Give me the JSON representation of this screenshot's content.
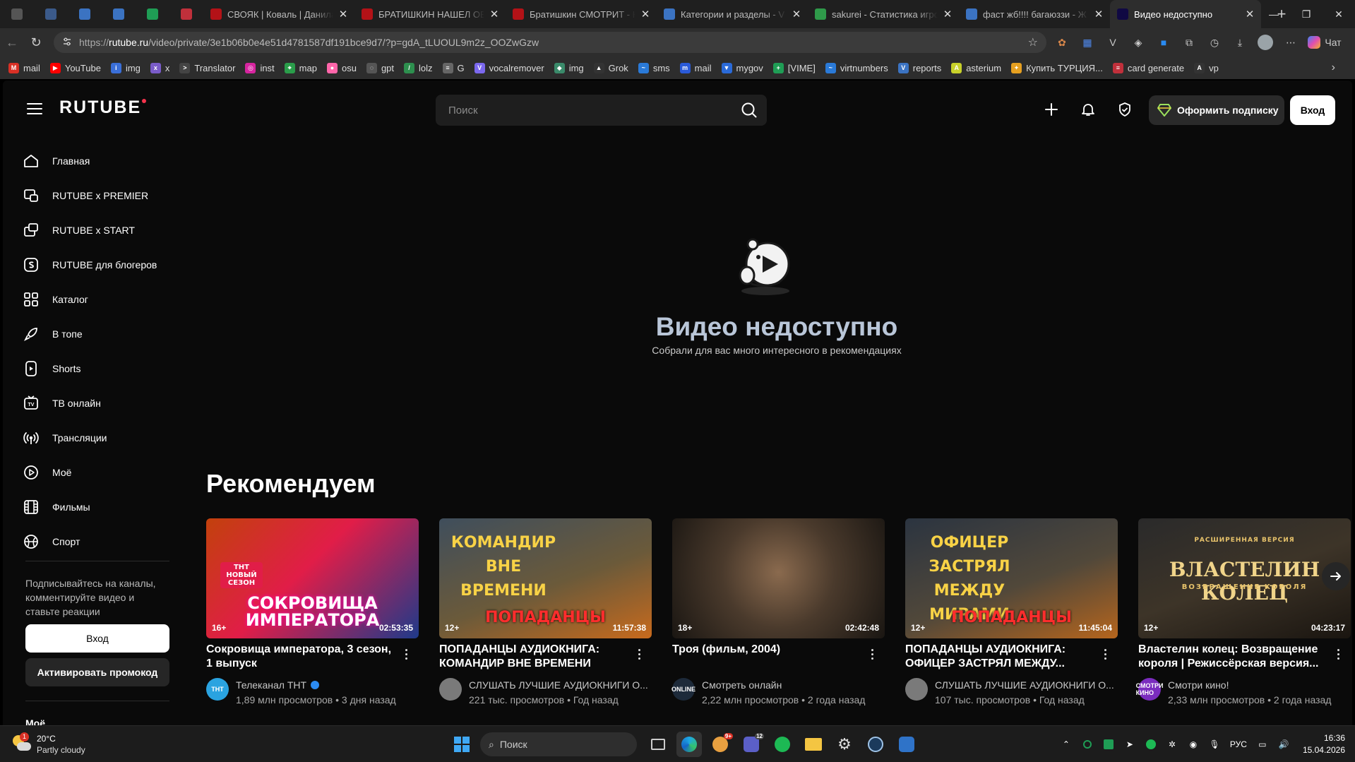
{
  "browser": {
    "tabs": [
      {
        "title": "",
        "pinned": true,
        "color": "#555555"
      },
      {
        "title": "",
        "pinned": true,
        "color": "#3b5a8a"
      },
      {
        "title": "",
        "pinned": true,
        "color": "#3b73c2"
      },
      {
        "title": "",
        "pinned": true,
        "color": "#3b73c2"
      },
      {
        "title": "",
        "pinned": true,
        "color": "#1f9d55"
      },
      {
        "title": "",
        "pinned": true,
        "color": "#c0303b"
      },
      {
        "title": "СВОЯК | Коваль | Данила",
        "pinned": false,
        "color": "#b31217"
      },
      {
        "title": "БРАТИШКИН НАШЕЛ ОБ",
        "pinned": false,
        "color": "#b31217"
      },
      {
        "title": "Братишкин СМОТРИТ - К",
        "pinned": false,
        "color": "#b31217"
      },
      {
        "title": "Категории и разделы - V",
        "pinned": false,
        "color": "#3b73c2"
      },
      {
        "title": "sakurei - Статистика игро",
        "pinned": false,
        "color": "#2f9a4a"
      },
      {
        "title": "фаст жб!!!! багаюззи - Ж",
        "pinned": false,
        "color": "#3b73c2"
      },
      {
        "title": "Видео недоступно",
        "pinned": false,
        "color": "#100943",
        "active": true
      }
    ],
    "url_protocol": "https://",
    "url_host": "rutube.ru",
    "url_path": "/video/private/3e1b06b0e4e51d4781587df191bce9d7/?p=gdA_tLUOUL9m2z_OOZwGzw",
    "copilot_label": "Чат",
    "bookmarks": [
      {
        "label": "mail",
        "color": "#d93025",
        "glyph": "M"
      },
      {
        "label": "YouTube",
        "color": "#ff0000",
        "glyph": "▶"
      },
      {
        "label": "img",
        "color": "#3a6fd8",
        "glyph": "i"
      },
      {
        "label": "x",
        "color": "#7a5cc9",
        "glyph": "x"
      },
      {
        "label": "Translator",
        "color": "#444444",
        "glyph": ">"
      },
      {
        "label": "inst",
        "color": "#d6249f",
        "glyph": "◎"
      },
      {
        "label": "map",
        "color": "#2a9d4a",
        "glyph": "⌖"
      },
      {
        "label": "osu",
        "color": "#ff66aa",
        "glyph": "●"
      },
      {
        "label": "gpt",
        "color": "#555555",
        "glyph": "◌"
      },
      {
        "label": "lolz",
        "color": "#2d8f4e",
        "glyph": "/"
      },
      {
        "label": "G",
        "color": "#666666",
        "glyph": "≡"
      },
      {
        "label": "vocalremover",
        "color": "#7b68ee",
        "glyph": "V"
      },
      {
        "label": "img",
        "color": "#3a8a6a",
        "glyph": "◆"
      },
      {
        "label": "Grok",
        "color": "#333333",
        "glyph": "▲"
      },
      {
        "label": "sms",
        "color": "#2a7ad8",
        "glyph": "~"
      },
      {
        "label": "mail",
        "color": "#2a5ad8",
        "glyph": "m"
      },
      {
        "label": "mygov",
        "color": "#2a6ad8",
        "glyph": "▼"
      },
      {
        "label": "[VIME]",
        "color": "#1f9d55",
        "glyph": "+"
      },
      {
        "label": "virtnumbers",
        "color": "#2a7ad8",
        "glyph": "~"
      },
      {
        "label": "reports",
        "color": "#3b73c2",
        "glyph": "V"
      },
      {
        "label": "asterium",
        "color": "#c8d12a",
        "glyph": "A"
      },
      {
        "label": "Купить ТУРЦИЯ...",
        "color": "#e6a020",
        "glyph": "✦"
      },
      {
        "label": "card generate",
        "color": "#c0303b",
        "glyph": "≡"
      },
      {
        "label": "vp",
        "color": "#333333",
        "glyph": "A"
      }
    ]
  },
  "header": {
    "logo": "RUTUBE",
    "search_placeholder": "Поиск",
    "subscribe_label": "Оформить подписку",
    "login_label": "Вход"
  },
  "sidebar": {
    "items": [
      {
        "label": "Главная",
        "icon": "home-icon"
      },
      {
        "label": "RUTUBE x PREMIER",
        "icon": "premier-icon"
      },
      {
        "label": "RUTUBE x START",
        "icon": "start-icon"
      },
      {
        "label": "RUTUBE для блогеров",
        "icon": "bloggers-icon"
      },
      {
        "label": "Каталог",
        "icon": "catalog-icon"
      },
      {
        "label": "В топе",
        "icon": "rocket-icon"
      },
      {
        "label": "Shorts",
        "icon": "shorts-icon"
      },
      {
        "label": "ТВ онлайн",
        "icon": "tv-icon"
      },
      {
        "label": "Трансляции",
        "icon": "broadcast-icon"
      },
      {
        "label": "Моё",
        "icon": "my-icon"
      },
      {
        "label": "Фильмы",
        "icon": "film-icon"
      },
      {
        "label": "Спорт",
        "icon": "sport-icon"
      }
    ],
    "note": "Подписывайтесь на каналы, комментируйте видео и ставьте реакции",
    "login_label": "Вход",
    "promo_label": "Активировать промокод",
    "cut_label": "Моё"
  },
  "unavailable": {
    "title": "Видео недоступно",
    "subtitle": "Собрали для вас много интересного в рекомендациях"
  },
  "recommend": {
    "title": "Рекомендуем",
    "cards": [
      {
        "title": "Сокровища императора, 3 сезон, 1 выпуск",
        "age": "16+",
        "duration": "02:53:35",
        "poster_top": "ТНТ НОВЫЙ СЕЗОН",
        "poster_main": "СОКРОВИЩА ИМПЕРАТОРА",
        "channel": "Телеканал ТНТ",
        "verified": true,
        "views": "1,89 млн просмотров",
        "ago": "3 дня назад",
        "avatar_label": "ТНТ",
        "avatar_color": "#2aa3e0"
      },
      {
        "title": "ПОПАДАНЦЫ АУДИОКНИГА: КОМАНДИР ВНЕ ВРЕМЕНИ",
        "age": "12+",
        "duration": "11:57:38",
        "poster_top": "КОМАНДИР ВНЕ ВРЕМЕНИ",
        "poster_main": "ПОПАДАНЦЫ",
        "channel": "СЛУШАТЬ ЛУЧШИЕ АУДИОКНИГИ О...",
        "verified": false,
        "views": "221 тыс. просмотров",
        "ago": "Год назад",
        "avatar_label": "",
        "avatar_color": "#7a7a7a"
      },
      {
        "title": "Троя (фильм, 2004)",
        "age": "18+",
        "duration": "02:42:48",
        "poster_top": "",
        "poster_main": "",
        "channel": "Смотреть онлайн",
        "verified": false,
        "views": "2,22 млн просмотров",
        "ago": "2 года назад",
        "avatar_label": "ONLINE",
        "avatar_color": "#1d2a3a"
      },
      {
        "title": "ПОПАДАНЦЫ АУДИОКНИГА: ОФИЦЕР ЗАСТРЯЛ МЕЖДУ...",
        "age": "12+",
        "duration": "11:45:04",
        "poster_top": "ОФИЦЕР ЗАСТРЯЛ МЕЖДУ МИРАМИ",
        "poster_main": "ПОПАДАНЦЫ",
        "channel": "СЛУШАТЬ ЛУЧШИЕ АУДИОКНИГИ О...",
        "verified": false,
        "views": "107 тыс. просмотров",
        "ago": "Год назад",
        "avatar_label": "",
        "avatar_color": "#7a7a7a"
      },
      {
        "title": "Властелин колец: Возвращение короля | Режиссёрская версия...",
        "age": "12+",
        "duration": "04:23:17",
        "poster_top": "РАСШИРЕННАЯ ВЕРСИЯ",
        "poster_main": "ВЛАСТЕЛИН КОЛЕЦ",
        "poster_sub": "ВОЗВРАЩЕНИЕ КОРОЛЯ",
        "channel": "Смотри кино!",
        "verified": false,
        "views": "2,33 млн просмотров",
        "ago": "2 года назад",
        "avatar_label": "СМОТРИ КИНО",
        "avatar_color": "#7b2cbf"
      }
    ]
  },
  "taskbar": {
    "temp": "20°C",
    "weather": "Partly cloudy",
    "weather_badge": "1",
    "search_label": "Поиск",
    "lang": "РУС",
    "time": "16:36",
    "date": "15.04.2026",
    "discord_badge": "9+",
    "teams_badge": "12"
  },
  "colors": {
    "accent_red": "#f5334c",
    "page_bg": "#0a0a0a",
    "unavailable_title": "#b9c6d8"
  }
}
